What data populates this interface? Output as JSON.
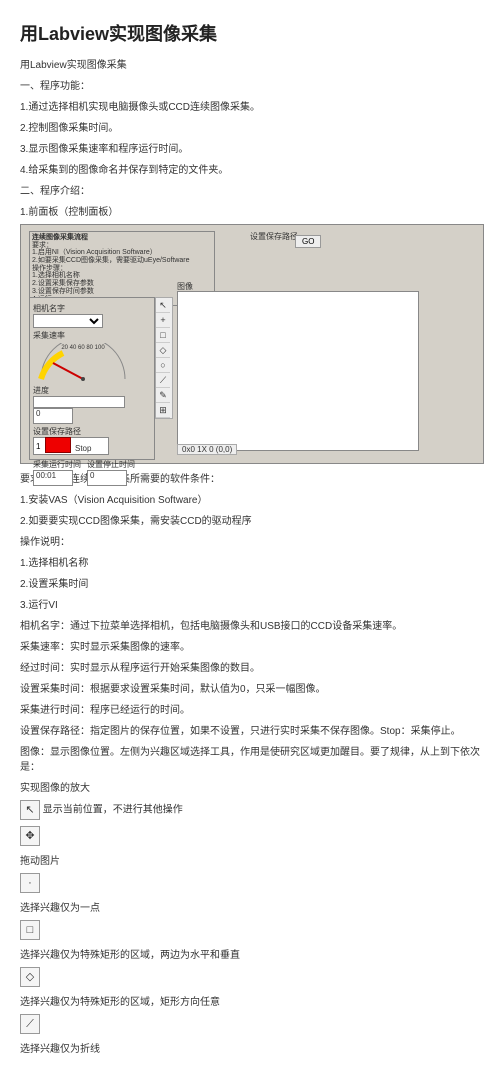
{
  "title": "用Labview实现图像采集",
  "intro": "用Labview实现图像采集",
  "sec_func": "一、程序功能：",
  "func_items": [
    "1.通过选择相机实现电脑摄像头或CCD连续图像采集。",
    "2.控制图像采集时间。",
    "3.显示图像采集速率和程序运行时间。",
    "4.给采集到的图像命名并保存到特定的文件夹。"
  ],
  "sec_intro": "二、程序介绍：",
  "front_panel": "1.前面板（控制面板）",
  "flow_title": "连续图像采集流程",
  "flow_lines": [
    "要求：",
    "1.启用NI（Vision Acquisition Software）",
    "2.如要采集CCD图像采集，需要驱动uEye/Software",
    "操作步骤：",
    "1.选择相机名称",
    "2.设置采集保存参数",
    "3.设置保存时间参数",
    "4.运行"
  ],
  "go_label": "设置保存路径",
  "go_btn": "GO",
  "ctrl": {
    "camera_lbl": "相机名字",
    "rate_lbl": "采集速率",
    "gauge_nums": "20  40  60  80  100",
    "gauge_ends": "0                    1",
    "progress_lbl": "进度",
    "progress_val": "0",
    "save_path_lbl": "设置保存路径",
    "save_path_val": "1  ",
    "run_time_lbl": "采集运行时间",
    "run_time_val": "00:01",
    "set_time_lbl": "设置停止时间",
    "set_time_val": "0",
    "stop": "Stop"
  },
  "image_lbl": "图像",
  "zoom": "0x0  1X  0 (0,0)",
  "tool_icons": [
    "↖",
    "+",
    "□",
    "◇",
    "○",
    "⟋",
    "✎",
    "⊞"
  ],
  "req_title": "要求：实现连续图像采集所需要的软件条件：",
  "req_items": [
    "1.安装VAS（Vision Acquisition Software）",
    "2.如要要实现CCD图像采集，需安装CCD的驱动程序"
  ],
  "op_title": "操作说明：",
  "op_items": [
    "1.选择相机名称",
    "2.设置采集时间",
    "3.运行VI"
  ],
  "desc_lines": [
    "相机名字：通过下拉菜单选择相机，包括电脑摄像头和USB接口的CCD设备采集速率。",
    "采集速率：实时显示采集图像的速率。",
    "经过时间：实时显示从程序运行开始采集图像的数目。",
    "设置采集时间：根据要求设置采集时间，默认值为0，只采一幅图像。",
    "采集进行时间：程序已经运行的时间。",
    "设置保存路径：指定图片的保存位置，如果不设置，只进行实时采集不保存图像。Stop：采集停止。",
    "图像：显示图像位置。左侧为兴趣区域选择工具，作用是使研究区域更加醒目。要了规律，从上到下依次是："
  ],
  "roi_title": "实现图像的放大",
  "roi_items": [
    {
      "icon": "↖",
      "text": "显示当前位置，不进行其他操作"
    },
    {
      "icon": "✥",
      "text": "拖动图片"
    },
    {
      "icon": "·",
      "text": "选择兴趣仅为一点"
    },
    {
      "icon": "□",
      "text": "选择兴趣仅为特殊矩形的区域，两边为水平和垂直"
    },
    {
      "icon": "◇",
      "text": "选择兴趣仅为特殊矩形的区域，矩形方向任意"
    },
    {
      "icon": "⟋",
      "text": "选择兴趣仅为折线"
    }
  ]
}
